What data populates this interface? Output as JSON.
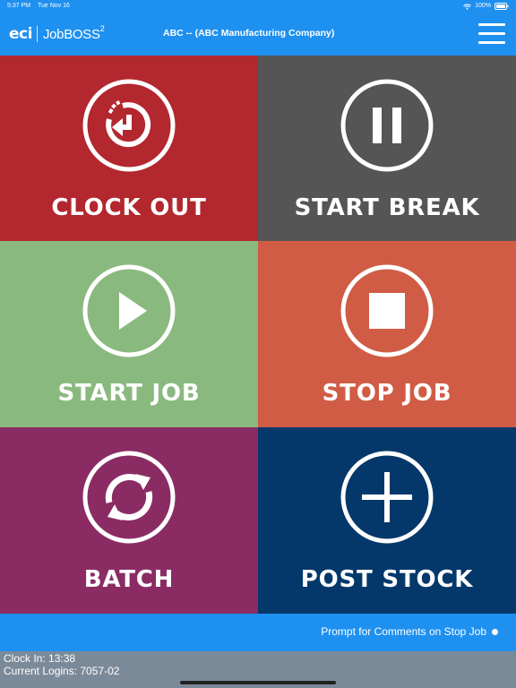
{
  "status_bar": {
    "time": "5:37 PM",
    "date": "Tue Nov 16",
    "battery": "100%"
  },
  "header": {
    "logo_brand": "eci",
    "logo_product": "JobBOSS",
    "logo_superscript": "2",
    "company": "ABC -- (ABC Manufacturing Company)",
    "background": "#1e90f0"
  },
  "tiles": [
    {
      "label": "CLOCK OUT",
      "icon": "clock-out-icon",
      "color": "#b3272e"
    },
    {
      "label": "START BREAK",
      "icon": "pause-icon",
      "color": "#555555"
    },
    {
      "label": "START JOB",
      "icon": "play-icon",
      "color": "#8ab97f"
    },
    {
      "label": "STOP JOB",
      "icon": "stop-icon",
      "color": "#d05c45"
    },
    {
      "label": "BATCH",
      "icon": "refresh-icon",
      "color": "#8a2c63"
    },
    {
      "label": "POST STOCK",
      "icon": "plus-icon",
      "color": "#04386a"
    }
  ],
  "footer": {
    "prompt_label": "Prompt for Comments on Stop Job"
  },
  "info": {
    "clock_in": "Clock In: 13:38",
    "current_logins": "Current Logins: 7057-02"
  }
}
